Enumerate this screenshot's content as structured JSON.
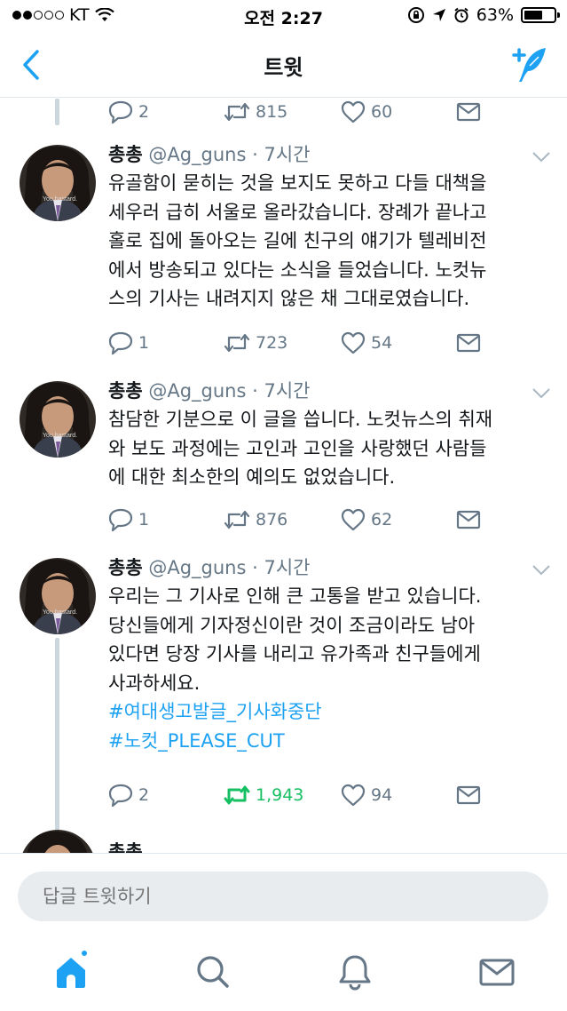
{
  "status_bar": {
    "carrier": "KT",
    "time": "오전 2:27",
    "battery": "63%",
    "battery_level": 0.63
  },
  "nav": {
    "title": "트윗",
    "back_icon": "chevron-left-icon",
    "compose_icon": "compose-tweet-icon"
  },
  "top_actions": {
    "replies": "2",
    "retweets": "815",
    "likes": "60"
  },
  "tweets": [
    {
      "name": "총총",
      "handle": "@Ag_guns",
      "time": "· 7시간",
      "lines": [
        "유골함이 묻히는 것을 보지도 못하고 다들 대책을",
        "세우러 급히 서울로 올라갔습니다. 장례가 끝나고",
        "홀로 집에 돌아오는 길에 친구의 얘기가 텔레비전",
        "에서 방송되고 있다는 소식을 들었습니다. 노컷뉴",
        "스의 기사는 내려지지 않은 채 그대로였습니다."
      ],
      "replies": "1",
      "retweets": "723",
      "likes": "54"
    },
    {
      "name": "총총",
      "handle": "@Ag_guns",
      "time": "· 7시간",
      "lines": [
        "참담한 기분으로 이 글을 씁니다. 노컷뉴스의 취재",
        "와 보도 과정에는 고인과 고인을 사랑했던 사람들",
        "에 대한 최소한의 예의도 없었습니다."
      ],
      "replies": "1",
      "retweets": "876",
      "likes": "62"
    },
    {
      "name": "총총",
      "handle": "@Ag_guns",
      "time": "· 7시간",
      "lines": [
        "우리는 그 기사로 인해 큰 고통을 받고 있습니다.",
        "당신들에게 기자정신이란 것이 조금이라도 남아",
        "있다면 당장 기사를 내리고 유가족과 친구들에게",
        "사과하세요."
      ],
      "hashtags": [
        "#여대생고발글_기사화중단",
        "#노컷_PLEASE_CUT"
      ],
      "replies": "2",
      "retweets": "1,943",
      "likes": "94"
    },
    {
      "name": "총총"
    }
  ],
  "reply_bar": {
    "placeholder": "답글 트윗하기"
  },
  "tab_bar": {
    "items": [
      "home-icon",
      "search-icon",
      "notifications-icon",
      "messages-icon"
    ]
  },
  "colors": {
    "accent": "#1da1f2",
    "retweet_active": "#17bf63",
    "muted": "#657786"
  }
}
